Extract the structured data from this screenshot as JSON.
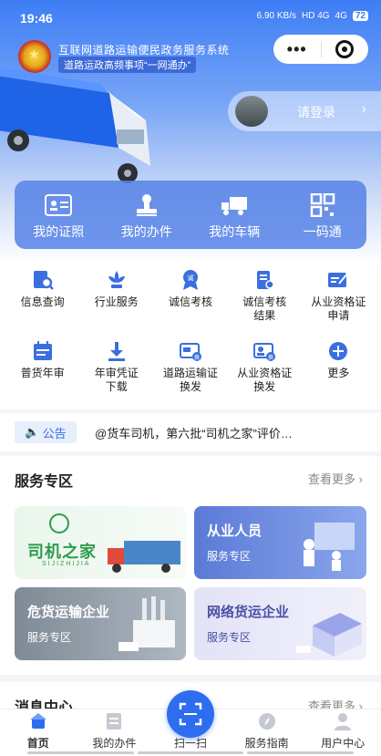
{
  "status": {
    "time": "19:46",
    "net": "6.90 KB/s",
    "signal1": "HD 4G",
    "signal2": "4G",
    "battery": "72"
  },
  "header": {
    "system_title": "互联网道路运输便民政务服务系统",
    "system_sub": "道路运政高频事项“一网通办”",
    "more_icon": "more-dots-icon",
    "close_icon": "target-icon"
  },
  "login": {
    "label": "请登录"
  },
  "quick_actions": [
    {
      "label": "我的证照",
      "icon": "id-card-icon"
    },
    {
      "label": "我的办件",
      "icon": "stamp-icon"
    },
    {
      "label": "我的车辆",
      "icon": "truck-icon"
    },
    {
      "label": "一码通",
      "icon": "qr-code-icon"
    }
  ],
  "services": [
    {
      "label": "信息查询",
      "icon": "doc-search-icon"
    },
    {
      "label": "行业服务",
      "icon": "lotus-icon"
    },
    {
      "label": "诚信考核",
      "icon": "badge-icon"
    },
    {
      "label": "诚信考核\n结果",
      "icon": "doc-result-icon"
    },
    {
      "label": "从业资格证\n申请",
      "icon": "edit-doc-icon"
    },
    {
      "label": "普货年审",
      "icon": "calendar-icon"
    },
    {
      "label": "年审凭证\n下载",
      "icon": "download-icon"
    },
    {
      "label": "道路运输证\n换发",
      "icon": "card-swap-icon"
    },
    {
      "label": "从业资格证\n换发",
      "icon": "person-card-icon"
    },
    {
      "label": "更多",
      "icon": "plus-circle-icon"
    }
  ],
  "notice": {
    "tag": "公告",
    "text": "@货车司机，第六批“司机之家”评价…"
  },
  "zone": {
    "title": "服务专区",
    "see_more": "查看更多",
    "cards": [
      {
        "title": "司机之家",
        "subtitle": "SIJIZHIJIA"
      },
      {
        "title": "从业人员",
        "subtitle": "服务专区"
      },
      {
        "title": "危货运输企业",
        "subtitle": "服务专区"
      },
      {
        "title": "网络货运企业",
        "subtitle": "服务专区"
      }
    ]
  },
  "messages": {
    "title": "消息中心",
    "see_more": "查看更多"
  },
  "tabs": [
    {
      "label": "首页",
      "icon": "home-icon"
    },
    {
      "label": "我的办件",
      "icon": "document-icon"
    },
    {
      "label": "扫一扫",
      "icon": "scan-icon"
    },
    {
      "label": "服务指南",
      "icon": "compass-icon"
    },
    {
      "label": "用户中心",
      "icon": "user-icon"
    }
  ],
  "colors": {
    "brand": "#2e6df0",
    "accent_green": "#2e9c4f"
  }
}
